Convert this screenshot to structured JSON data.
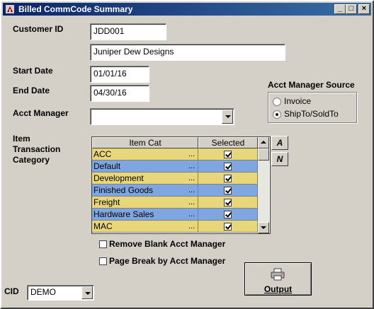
{
  "window": {
    "title": "Billed CommCode Summary"
  },
  "titlebar_buttons": {
    "minimize": "_",
    "maximize": "□",
    "close": "×"
  },
  "customer": {
    "label": "Customer ID",
    "id_value": "JDD001",
    "name_value": "Juniper Dew Designs"
  },
  "dates": {
    "start_label": "Start Date",
    "start_value": "01/01/16",
    "end_label": "End Date",
    "end_value": "04/30/16"
  },
  "acct_manager": {
    "label": "Acct Manager",
    "value": ""
  },
  "acct_manager_source": {
    "label": "Acct Manager Source",
    "options": [
      {
        "label": "Invoice",
        "selected": false
      },
      {
        "label": "ShipTo/SoldTo",
        "selected": true
      }
    ]
  },
  "item_category": {
    "label_line1": "Item",
    "label_line2": "Transaction",
    "label_line3": "Category",
    "columns": [
      "Item Cat",
      "Selected"
    ],
    "ellipsis": "...",
    "rows": [
      {
        "name": "ACC",
        "selected": true
      },
      {
        "name": "Default",
        "selected": true
      },
      {
        "name": "Development",
        "selected": true
      },
      {
        "name": "Finished Goods",
        "selected": true
      },
      {
        "name": "Freight",
        "selected": true
      },
      {
        "name": "Hardware Sales",
        "selected": true
      },
      {
        "name": "MAC",
        "selected": true
      }
    ],
    "row_colors": [
      "#e8d67a",
      "#7ea6e0"
    ],
    "all_button": "A",
    "none_button": "N"
  },
  "options": {
    "remove_blank": {
      "label": "Remove Blank Acct Manager",
      "checked": false
    },
    "page_break": {
      "label": "Page Break by Acct Manager",
      "checked": false
    }
  },
  "cid": {
    "label": "CID",
    "value": "DEMO"
  },
  "output_button": {
    "label": "Output",
    "icon": "printer-icon"
  }
}
